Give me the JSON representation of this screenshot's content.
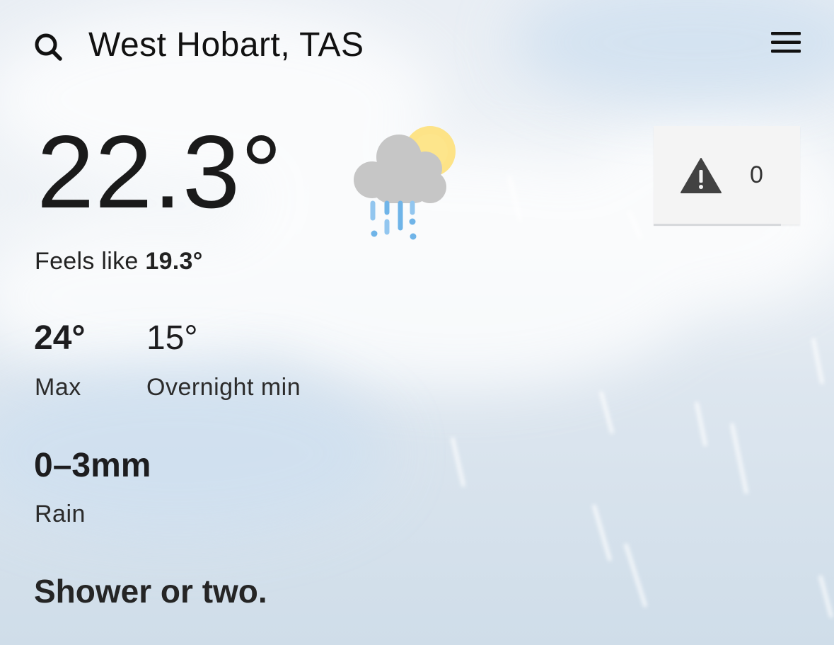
{
  "header": {
    "location": "West Hobart, TAS",
    "search_icon": "search-icon",
    "menu_icon": "hamburger-menu-icon"
  },
  "current": {
    "temperature": "22.3°",
    "feels_like_label": "Feels like",
    "feels_like_value": "19.3°",
    "condition_icon": "rain-cloud-sun-icon"
  },
  "warnings": {
    "icon": "warning-triangle-icon",
    "count": "0"
  },
  "forecast": {
    "max_value": "24°",
    "max_label": "Max",
    "min_value": "15°",
    "min_label": "Overnight min",
    "rain_value": "0–3mm",
    "rain_label": "Rain",
    "summary": "Shower or two."
  },
  "colors": {
    "sun": "#fde387",
    "cloud": "#c8c8c8",
    "rain_drops": "#6fb4e8",
    "warning_icon": "#424242",
    "card_bg": "#f4f4f4"
  }
}
